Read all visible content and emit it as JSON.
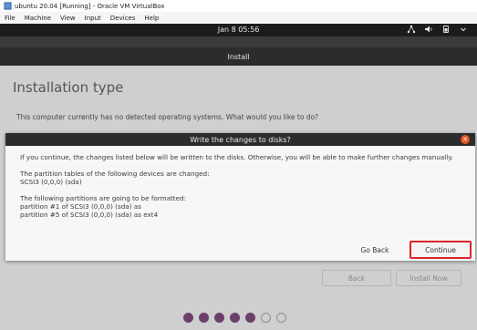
{
  "window": {
    "title": "ubuntu 20.04 [Running] - Oracle VM VirtualBox"
  },
  "menu": [
    "File",
    "Machine",
    "View",
    "Input",
    "Devices",
    "Help"
  ],
  "topbar": {
    "clock": "Jan 8  05:56"
  },
  "installer": {
    "title": "Install",
    "heading": "Installation type",
    "description": "This computer currently has no detected operating systems. What would you like to do?",
    "back_label": "Back",
    "install_now_label": "Install Now"
  },
  "dialog": {
    "title": "Write the changes to disks?",
    "intro": "If you continue, the changes listed below will be written to the disks. Otherwise, you will be able to make further changes manually.",
    "changed_heading": "The partition tables of the following devices are changed:",
    "changed_device": "SCSI3 (0,0,0) (sda)",
    "format_heading": "The following partitions are going to be formatted:",
    "format_items": [
      "partition #1 of SCSI3 (0,0,0) (sda) as",
      "partition #5 of SCSI3 (0,0,0) (sda) as ext4"
    ],
    "go_back_label": "Go Back",
    "continue_label": "Continue"
  },
  "progress": {
    "total_steps": 7,
    "completed_steps": 5
  },
  "colors": {
    "accent": "#e95420",
    "highlight": "#d9262a",
    "progress_dot": "#6c3f68"
  }
}
